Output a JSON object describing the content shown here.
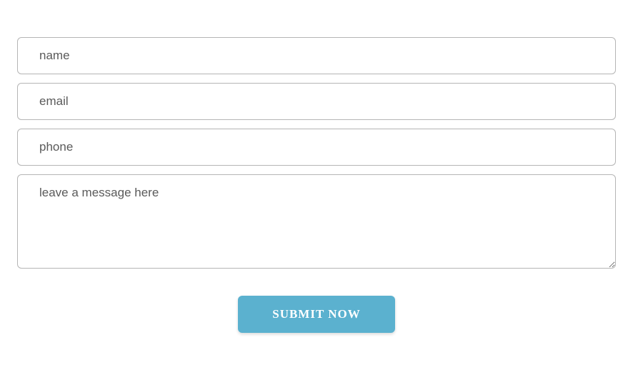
{
  "form": {
    "name": {
      "placeholder": "name",
      "value": ""
    },
    "email": {
      "placeholder": "email",
      "value": ""
    },
    "phone": {
      "placeholder": "phone",
      "value": ""
    },
    "message": {
      "placeholder": "leave a message here",
      "value": ""
    },
    "submit_label": "SUBMIT NOW"
  }
}
